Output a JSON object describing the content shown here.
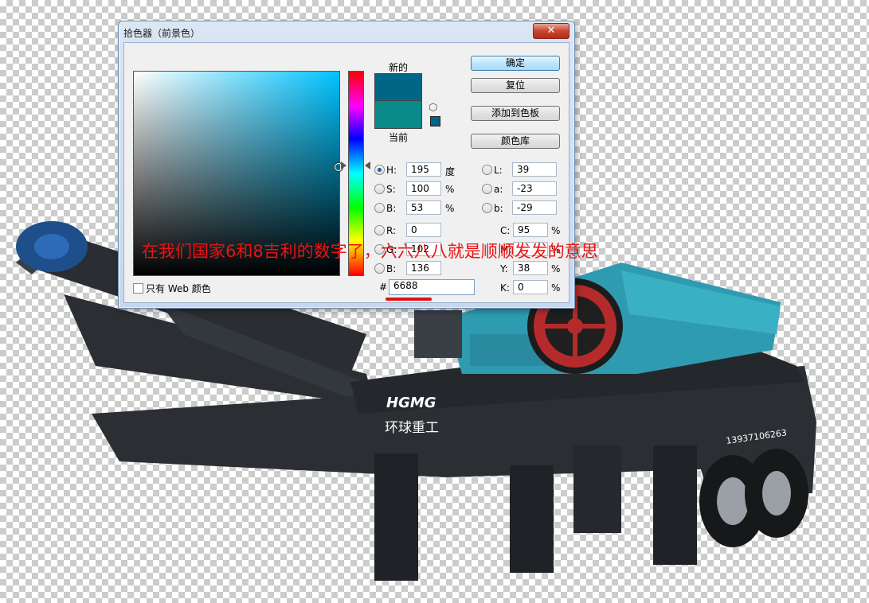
{
  "window": {
    "title": "拾色器（前景色）",
    "close_label": "✕"
  },
  "swatches": {
    "new_label": "新的",
    "current_label": "当前",
    "new_color": "#006688",
    "current_color": "#0a8a88"
  },
  "buttons": {
    "ok": "确定",
    "reset": "复位",
    "add_to_swatches": "添加到色板",
    "color_libraries": "颜色库"
  },
  "hsb": [
    {
      "label": "H:",
      "value": "195",
      "unit": "度",
      "selected": true
    },
    {
      "label": "S:",
      "value": "100",
      "unit": "%",
      "selected": false
    },
    {
      "label": "B:",
      "value": "53",
      "unit": "%",
      "selected": false
    }
  ],
  "rgb": [
    {
      "label": "R:",
      "value": "0"
    },
    {
      "label": "G:",
      "value": "102"
    },
    {
      "label": "B:",
      "value": "136"
    }
  ],
  "lab": [
    {
      "label": "L:",
      "value": "39"
    },
    {
      "label": "a:",
      "value": "-23"
    },
    {
      "label": "b:",
      "value": "-29"
    }
  ],
  "cmyk": [
    {
      "label": "C:",
      "value": "95",
      "unit": "%"
    },
    {
      "label": "M:",
      "value": "",
      "unit": "%"
    },
    {
      "label": "Y:",
      "value": "38",
      "unit": "%"
    },
    {
      "label": "K:",
      "value": "0",
      "unit": "%"
    }
  ],
  "hex": {
    "label": "#",
    "value": "6688"
  },
  "web_only": {
    "label": "只有 Web 颜色"
  },
  "annotation": {
    "text": "在我们国家6和8吉利的数字了，六六八八就是顺顺发发的意思",
    "color": "#ee1111"
  },
  "machine": {
    "logo_text": "HGMG",
    "brand_text": "环球重工",
    "phone_text": "13937106263"
  },
  "colors": {
    "accent_blue": "#3c7fb1",
    "machine_body": "#2b2f33",
    "machine_teal": "#2f9bb0",
    "wheel_red": "#b52b2b"
  }
}
